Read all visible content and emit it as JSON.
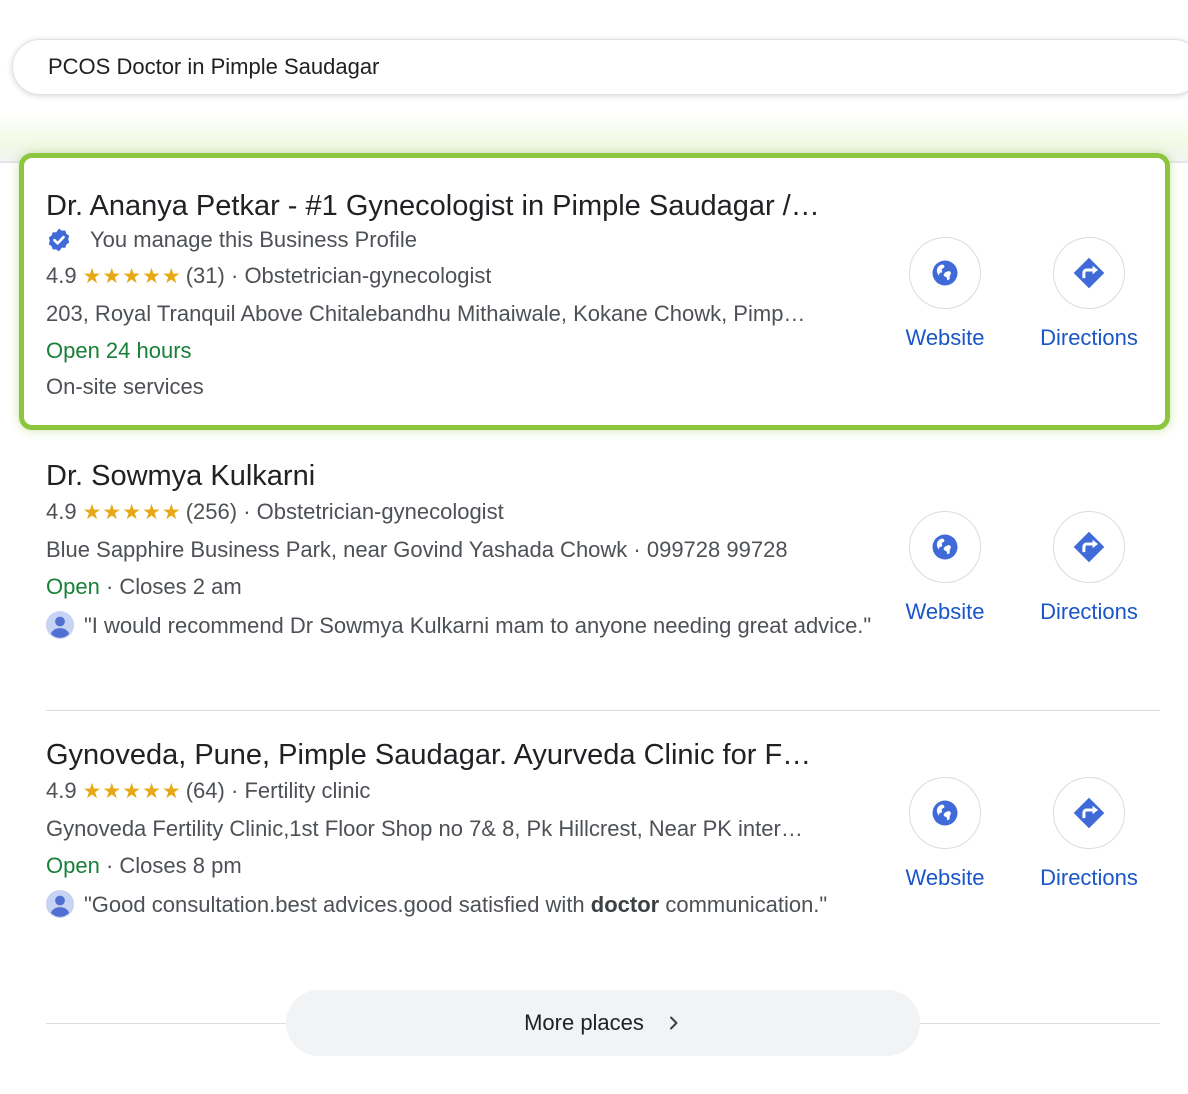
{
  "search": {
    "query": "PCOS Doctor in Pimple Saudagar"
  },
  "listings": [
    {
      "title": "Dr. Ananya Petkar - #1 Gynecologist in Pimple Saudagar /…",
      "verified_text": "You manage this Business Profile",
      "rating": "4.9",
      "stars": "★★★★★",
      "reviews": "(31)",
      "sep": "·",
      "category": "Obstetrician-gynecologist",
      "address": "203, Royal Tranquil Above Chitalebandhu Mithaiwale, Kokane Chowk, Pimp…",
      "status": "Open 24 hours",
      "extra": "On-site services",
      "website_label": "Website",
      "directions_label": "Directions"
    },
    {
      "title": "Dr. Sowmya Kulkarni",
      "rating": "4.9",
      "stars": "★★★★★",
      "reviews": "(256)",
      "sep": "·",
      "category": "Obstetrician-gynecologist",
      "address": "Blue Sapphire Business Park, near Govind Yashada Chowk · 099728 99728",
      "status": "Open",
      "hours": "Closes 2 am",
      "review": "\"I would recommend Dr Sowmya Kulkarni mam to anyone needing great advice.\"",
      "website_label": "Website",
      "directions_label": "Directions"
    },
    {
      "title": "Gynoveda, Pune, Pimple Saudagar. Ayurveda Clinic for F…",
      "rating": "4.9",
      "stars": "★★★★★",
      "reviews": "(64)",
      "sep": "·",
      "category": "Fertility clinic",
      "address": "Gynoveda Fertility Clinic,1st Floor Shop no 7& 8, Pk Hillcrest, Near PK inter…",
      "status": "Open",
      "hours": "Closes 8 pm",
      "review_before": "\"Good consultation.best advices.good satisfied with ",
      "review_bold": "doctor",
      "review_after": " communication.\"",
      "website_label": "Website",
      "directions_label": "Directions"
    }
  ],
  "more_places": {
    "label": "More places"
  },
  "colors": {
    "highlight_border": "#8cc63f",
    "open": "#188038",
    "link": "#1a56c8",
    "star": "#e6a817",
    "icon_blue": "#3f6ad8"
  }
}
